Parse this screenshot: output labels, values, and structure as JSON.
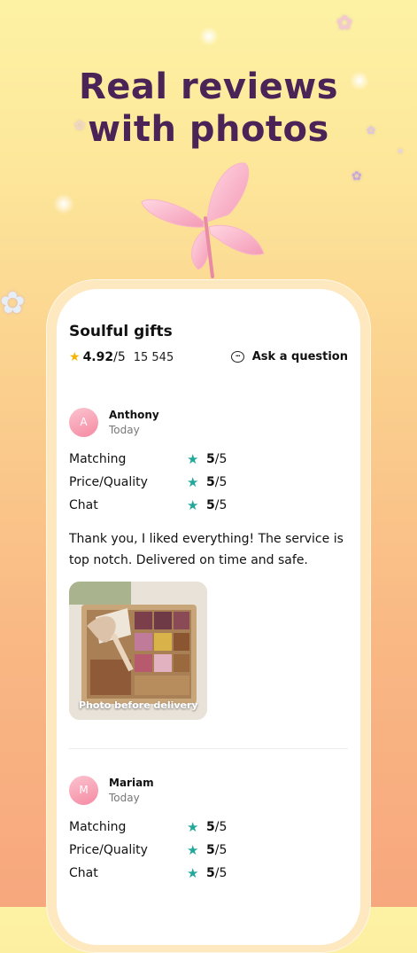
{
  "headline": {
    "line1": "Real reviews",
    "line2": "with photos"
  },
  "shop": {
    "name": "Soulful gifts",
    "rating": "4.92",
    "rating_suffix": "/5",
    "reviews_count": "15 545",
    "ask_label": "Ask a question",
    "ask_icon": "chat-bubble-icon"
  },
  "reviews": [
    {
      "initial": "A",
      "name": "Anthony",
      "date": "Today",
      "criteria": [
        {
          "label": "Matching",
          "score": "5",
          "suffix": "/5"
        },
        {
          "label": "Price/Quality",
          "score": "5",
          "suffix": "/5"
        },
        {
          "label": "Chat",
          "score": "5",
          "suffix": "/5"
        }
      ],
      "comment": "Thank you, I liked everything! The service is top notch. Delivered on time and safe.",
      "photo_caption": "Photo before delivery"
    },
    {
      "initial": "M",
      "name": "Mariam",
      "date": "Today",
      "criteria": [
        {
          "label": "Matching",
          "score": "5",
          "suffix": "/5"
        },
        {
          "label": "Price/Quality",
          "score": "5",
          "suffix": "/5"
        },
        {
          "label": "Chat",
          "score": "5",
          "suffix": "/5"
        }
      ]
    }
  ],
  "colors": {
    "headline": "#4a2357",
    "star_rating": "#f6b400",
    "star_criteria": "#22a89a",
    "avatar": "#f58aa3"
  }
}
